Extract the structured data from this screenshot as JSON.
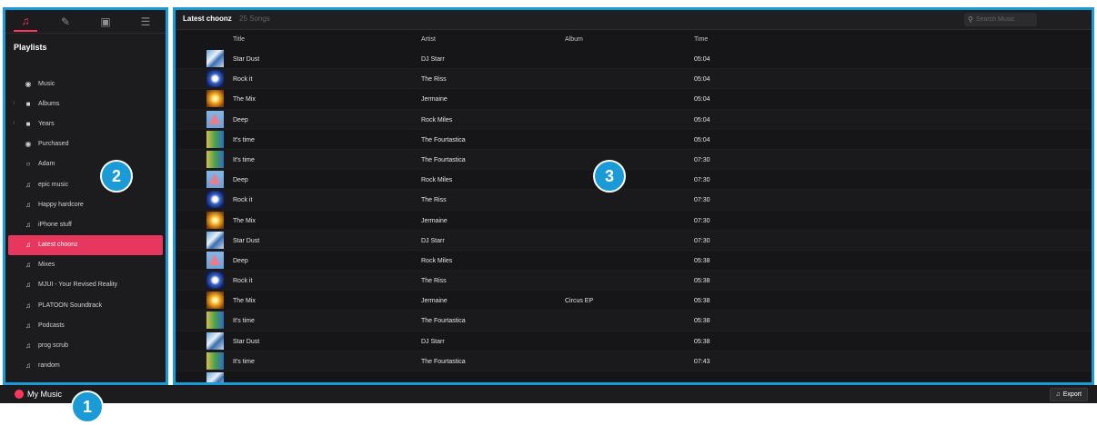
{
  "sidebar": {
    "tabs": [
      {
        "icon": "music-note-icon",
        "glyph": "♫"
      },
      {
        "icon": "pencil-icon",
        "glyph": "✎"
      },
      {
        "icon": "save-icon",
        "glyph": "▣"
      },
      {
        "icon": "archive-icon",
        "glyph": "☰"
      }
    ],
    "heading": "Playlists",
    "items": [
      {
        "label": "Music",
        "icon": "music-circle-icon",
        "glyph": "◉",
        "chevron": false
      },
      {
        "label": "Albums",
        "icon": "folder-icon",
        "glyph": "■",
        "chevron": true
      },
      {
        "label": "Years",
        "icon": "folder-icon",
        "glyph": "■",
        "chevron": true
      },
      {
        "label": "Purchased",
        "icon": "purchase-icon",
        "glyph": "◉",
        "chevron": false
      },
      {
        "label": "Adam",
        "icon": "radio-icon",
        "glyph": "○",
        "chevron": false
      },
      {
        "label": "epic music",
        "icon": "playlist-icon",
        "glyph": "♫",
        "chevron": false
      },
      {
        "label": "Happy hardcore",
        "icon": "playlist-icon",
        "glyph": "♫",
        "chevron": false
      },
      {
        "label": "iPhone stuff",
        "icon": "playlist-icon",
        "glyph": "♫",
        "chevron": false
      },
      {
        "label": "Latest choonz",
        "icon": "playlist-icon",
        "glyph": "♫",
        "chevron": false,
        "selected": true
      },
      {
        "label": "Mixes",
        "icon": "playlist-icon",
        "glyph": "♫",
        "chevron": false
      },
      {
        "label": "MJUI - Your Revised Reality",
        "icon": "playlist-icon",
        "glyph": "♫",
        "chevron": false
      },
      {
        "label": "PLATOON Soundtrack",
        "icon": "playlist-icon",
        "glyph": "♫",
        "chevron": false
      },
      {
        "label": "Podcasts",
        "icon": "playlist-icon",
        "glyph": "♫",
        "chevron": false
      },
      {
        "label": "prog scrub",
        "icon": "playlist-icon",
        "glyph": "♫",
        "chevron": false
      },
      {
        "label": "random",
        "icon": "playlist-icon",
        "glyph": "♫",
        "chevron": false
      }
    ]
  },
  "main": {
    "title": "Latest choonz",
    "count": "25 Songs",
    "search_placeholder": "Search Music",
    "columns": {
      "title": "Title",
      "artist": "Artist",
      "album": "Album",
      "time": "Time"
    },
    "rows": [
      {
        "art": "a1",
        "title": "Star Dust",
        "artist": "DJ Starr",
        "album": "",
        "time": "05:04"
      },
      {
        "art": "a2",
        "title": "Rock it",
        "artist": "The Riss",
        "album": "",
        "time": "05:04"
      },
      {
        "art": "a3",
        "title": "The Mix",
        "artist": "Jermaine",
        "album": "",
        "time": "05:04"
      },
      {
        "art": "a4",
        "title": "Deep",
        "artist": "Rock Miles",
        "album": "",
        "time": "05:04"
      },
      {
        "art": "a5",
        "title": "It's time",
        "artist": "The Fourtastica",
        "album": "",
        "time": "05:04"
      },
      {
        "art": "a5",
        "title": "It's time",
        "artist": "The Fourtastica",
        "album": "",
        "time": "07:30"
      },
      {
        "art": "a4",
        "title": "Deep",
        "artist": "Rock Miles",
        "album": "",
        "time": "07:30"
      },
      {
        "art": "a2",
        "title": "Rock it",
        "artist": "The Riss",
        "album": "",
        "time": "07:30"
      },
      {
        "art": "a3",
        "title": "The Mix",
        "artist": "Jermaine",
        "album": "",
        "time": "07:30"
      },
      {
        "art": "a1",
        "title": "Star Dust",
        "artist": "DJ Starr",
        "album": "",
        "time": "07:30"
      },
      {
        "art": "a4",
        "title": "Deep",
        "artist": "Rock Miles",
        "album": "",
        "time": "05:38"
      },
      {
        "art": "a2",
        "title": "Rock it",
        "artist": "The Riss",
        "album": "",
        "time": "05:38"
      },
      {
        "art": "a3",
        "title": "The Mix",
        "artist": "Jermaine",
        "album": "Circus EP",
        "time": "05:38"
      },
      {
        "art": "a5",
        "title": "It's time",
        "artist": "The Fourtastica",
        "album": "",
        "time": "05:38"
      },
      {
        "art": "a1",
        "title": "Star Dust",
        "artist": "DJ Starr",
        "album": "",
        "time": "05:38"
      },
      {
        "art": "a5",
        "title": "It's time",
        "artist": "The Fourtastica",
        "album": "",
        "time": "07:43"
      },
      {
        "art": "a1",
        "title": "",
        "artist": "",
        "album": "",
        "time": ""
      }
    ]
  },
  "bottom": {
    "my_music": "My Music",
    "export": "Export"
  },
  "callouts": [
    "1",
    "2",
    "3"
  ],
  "colors": {
    "accent": "#ff375f",
    "highlight_border": "#1a9bd7",
    "selected_row": "#e8375e"
  }
}
